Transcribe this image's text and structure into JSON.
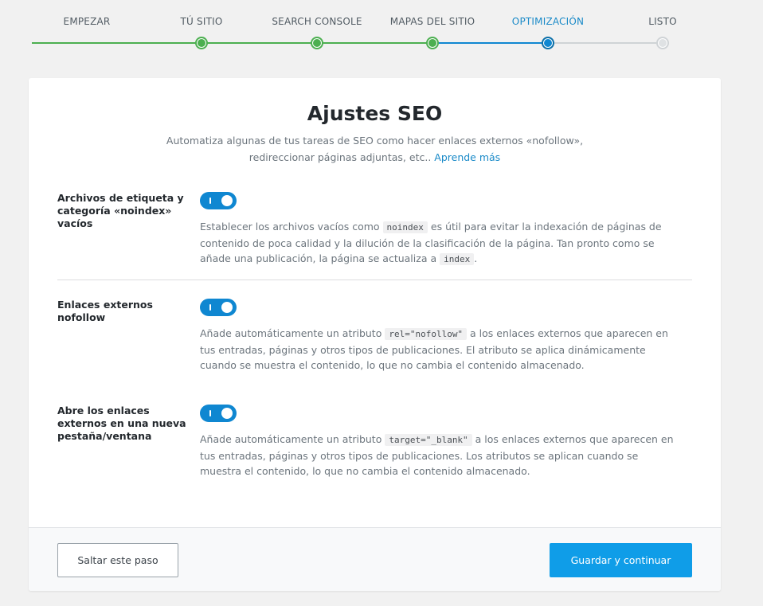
{
  "colors": {
    "done": "#4caf50",
    "active": "#0f87d1",
    "pending": "#cfd3d6",
    "primary_button": "#0f9de8",
    "link": "#1a8ac8"
  },
  "steps": [
    {
      "label": "EMPEZAR",
      "state": "done"
    },
    {
      "label": "TÚ SITIO",
      "state": "done"
    },
    {
      "label": "SEARCH CONSOLE",
      "state": "done"
    },
    {
      "label": "MAPAS DEL SITIO",
      "state": "done"
    },
    {
      "label": "OPTIMIZACIÓN",
      "state": "current"
    },
    {
      "label": "LISTO",
      "state": "pending"
    }
  ],
  "card": {
    "title": "Ajustes SEO",
    "subtitle_1": "Automatiza algunas de tus tareas de SEO como hacer enlaces externos «nofollow», ",
    "subtitle_2": "redireccionar páginas adjuntas, etc..",
    "learn_more": "Aprende más"
  },
  "settings": [
    {
      "label": "Archivos de etiqueta y categoría «noindex» vacíos",
      "enabled": true,
      "desc_1": "Establecer los archivos vacíos como",
      "code_1": "noindex",
      "desc_2": "es útil para evitar la indexación de páginas de contenido de poca calidad y la dilución de la clasificación de la página. Tan pronto como se añade una publicación, la página se actualiza a",
      "code_2": "index",
      "desc_3": "."
    },
    {
      "label": "Enlaces externos nofollow",
      "enabled": true,
      "desc_1": "Añade automáticamente un atributo",
      "code_1": "rel=\"nofollow\"",
      "desc_2": "a los enlaces externos que aparecen en tus entradas, páginas y otros tipos de publicaciones. El atributo se aplica dinámicamente cuando se muestra el contenido, lo que no cambia el contenido almacenado."
    },
    {
      "label": "Abre los enlaces externos en una nueva pestaña/ventana",
      "enabled": true,
      "desc_1": "Añade automáticamente un atributo",
      "code_1": "target=\"_blank\"",
      "desc_2": "a los enlaces externos que aparecen en tus entradas, páginas y otros tipos de publicaciones. Los atributos se aplican cuando se muestra el contenido, lo que no cambia el contenido almacenado."
    }
  ],
  "footer": {
    "skip_label": "Saltar este paso",
    "save_label": "Guardar y continuar"
  }
}
